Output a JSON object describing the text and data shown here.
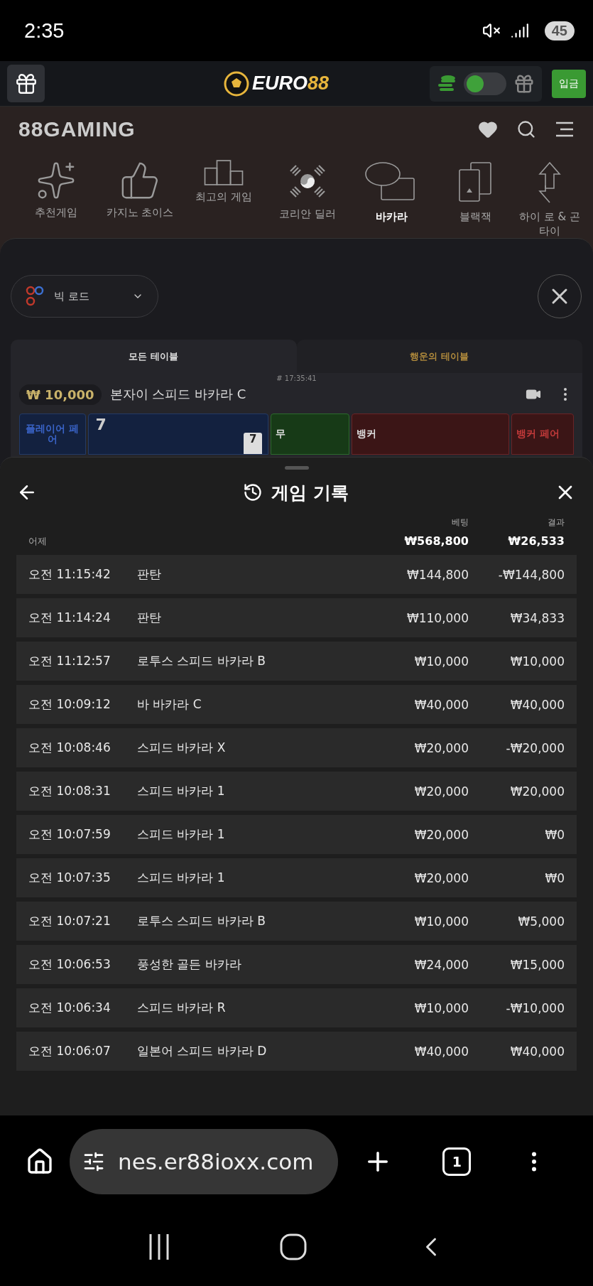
{
  "status_bar": {
    "time": "2:35",
    "battery": "45"
  },
  "header": {
    "logo_text": "EURO",
    "logo_accent": "88",
    "toggle_on": true,
    "deposit": "입금"
  },
  "brand": {
    "name": "88GAMING"
  },
  "categories": [
    {
      "kind": "sparkles",
      "label": "추천게임",
      "selected": false
    },
    {
      "kind": "thumbs",
      "label": "카지노 초이스",
      "selected": false
    },
    {
      "kind": "podium",
      "label": "최고의 게임",
      "selected": false
    },
    {
      "kind": "flag",
      "label": "코리안 딜러",
      "selected": false
    },
    {
      "kind": "baccarat",
      "label": "바카라",
      "selected": true
    },
    {
      "kind": "cards",
      "label": "블랙잭",
      "selected": false
    },
    {
      "kind": "hilo",
      "label": "하이 로 & 곤타이",
      "selected": false
    }
  ],
  "road_select": {
    "label": "빅 로드"
  },
  "tabs": [
    {
      "label": "모든 테이블",
      "selected": true
    },
    {
      "label": "행운의 테이블",
      "selected": false
    }
  ],
  "table": {
    "round": "# 17:35:41",
    "min_bet": "₩ 10,000",
    "name": "본자이 스피드 바카라 C",
    "player_score": "7",
    "card": "7",
    "tiles": [
      {
        "kind": "player_pair",
        "label": "플레이어 페어"
      },
      {
        "kind": "tie",
        "label": "무"
      },
      {
        "kind": "banker",
        "label": "뱅커"
      },
      {
        "kind": "banker_pair",
        "label": "뱅커 페어"
      }
    ]
  },
  "history": {
    "title": "게임 기록",
    "bet_header": "베팅",
    "result_header": "결과",
    "day": "어제",
    "bet_total": "₩568,800",
    "result_total": "₩26,533",
    "rows": [
      {
        "time": "오전 11:15:42",
        "game": "판탄",
        "bet": "₩144,800",
        "result": "-₩144,800"
      },
      {
        "time": "오전 11:14:24",
        "game": "판탄",
        "bet": "₩110,000",
        "result": "₩34,833"
      },
      {
        "time": "오전 11:12:57",
        "game": "로투스 스피드 바카라 B",
        "bet": "₩10,000",
        "result": "₩10,000"
      },
      {
        "time": "오전 10:09:12",
        "game": "바 바카라 C",
        "bet": "₩40,000",
        "result": "₩40,000"
      },
      {
        "time": "오전 10:08:46",
        "game": "스피드 바카라 X",
        "bet": "₩20,000",
        "result": "-₩20,000"
      },
      {
        "time": "오전 10:08:31",
        "game": "스피드 바카라 1",
        "bet": "₩20,000",
        "result": "₩20,000"
      },
      {
        "time": "오전 10:07:59",
        "game": "스피드 바카라 1",
        "bet": "₩20,000",
        "result": "₩0"
      },
      {
        "time": "오전 10:07:35",
        "game": "스피드 바카라 1",
        "bet": "₩20,000",
        "result": "₩0"
      },
      {
        "time": "오전 10:07:21",
        "game": "로투스 스피드 바카라 B",
        "bet": "₩10,000",
        "result": "₩5,000"
      },
      {
        "time": "오전 10:06:53",
        "game": "풍성한 골든 바카라",
        "bet": "₩24,000",
        "result": "₩15,000"
      },
      {
        "time": "오전 10:06:34",
        "game": "스피드 바카라 R",
        "bet": "₩10,000",
        "result": "-₩10,000"
      },
      {
        "time": "오전 10:06:07",
        "game": "일본어 스피드 바카라 D",
        "bet": "₩40,000",
        "result": "₩40,000"
      }
    ]
  },
  "browser": {
    "url": "nes.er88ioxx.com",
    "tab_count": "1"
  }
}
